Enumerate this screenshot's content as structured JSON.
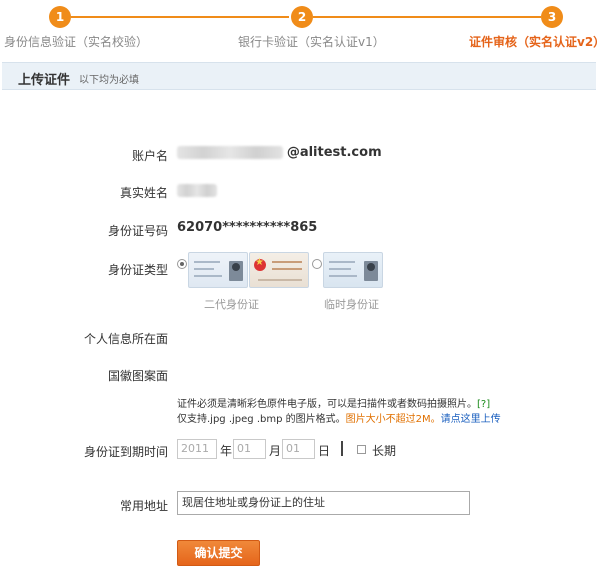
{
  "steps": [
    {
      "number": "1",
      "label": "身份信息验证（实名校验）"
    },
    {
      "number": "2",
      "label": "银行卡验证（实名认证v1）"
    },
    {
      "number": "3",
      "label": "证件审核（实名认证v2）"
    }
  ],
  "colors": {
    "accent": "#f08c19",
    "active_step": "#e5641a",
    "header_bg": "#eaf1f7",
    "submit_bg": "#e5651b"
  },
  "section": {
    "title": "上传证件",
    "subtitle": "以下均为必填"
  },
  "form": {
    "account": {
      "label": "账户名",
      "domain": "@alitest.com"
    },
    "real_name": {
      "label": "真实姓名"
    },
    "id_number": {
      "label": "身份证号码",
      "value": "62070**********865"
    },
    "id_type": {
      "label": "身份证类型",
      "options": [
        {
          "caption": "二代身份证",
          "selected": true
        },
        {
          "caption": "临时身份证",
          "selected": false
        }
      ]
    },
    "personal_face": {
      "label": "个人信息所在面"
    },
    "emblem_face": {
      "label": "国徽图案面"
    },
    "notes": {
      "line1": "证件必须是清晰彩色原件电子版，可以是扫描件或者数码拍摄照片。",
      "help": "[?]",
      "line2_a": "仅支持.jpg .jpeg .bmp 的图片格式。",
      "line2_warn": "图片大小不超过2M。",
      "line2_link": "请点这里上传"
    },
    "expiry": {
      "label": "身份证到期时间",
      "year_placeholder": "2011",
      "year_unit": "年",
      "month_placeholder": "01",
      "month_unit": "月",
      "day_placeholder": "01",
      "day_unit": "日",
      "long_term": "长期"
    },
    "address": {
      "label": "常用地址",
      "value": "现居住地址或身份证上的住址"
    },
    "submit_label": "确认提交"
  }
}
